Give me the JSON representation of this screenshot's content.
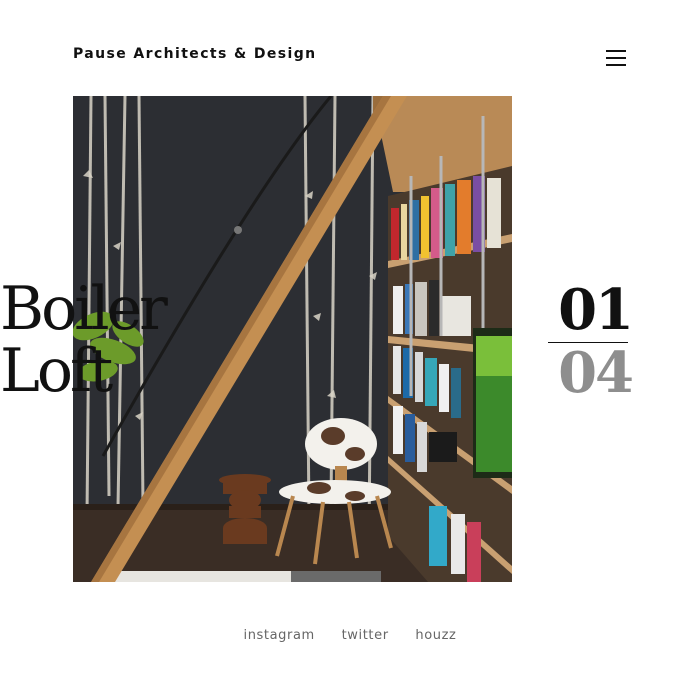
{
  "header": {
    "brand": "Pause Architects & Design",
    "menu_icon": "hamburger-menu-icon"
  },
  "hero": {
    "image_icon": "project-photo"
  },
  "project": {
    "title_line1": "Boiler",
    "title_line2": "Loft"
  },
  "counter": {
    "current": "01",
    "total": "04"
  },
  "social": {
    "links": [
      "instagram",
      "twitter",
      "houzz"
    ]
  },
  "colors": {
    "text": "#111111",
    "muted": "#8e8e8e",
    "background": "#ffffff"
  }
}
